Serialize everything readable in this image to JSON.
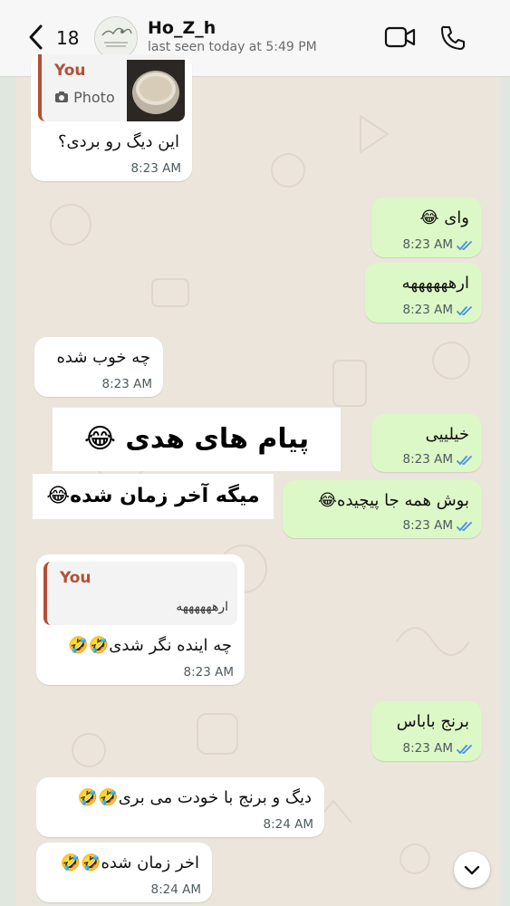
{
  "header": {
    "back_count": "18",
    "contact_name": "Ho_Z_h",
    "last_seen": "last seen today at 5:49 PM"
  },
  "messages": [
    {
      "dir": "in",
      "quote_author": "You",
      "quote_text": "Photo",
      "text": "این دیگ رو بردی؟",
      "time": "8:23 AM"
    },
    {
      "dir": "out",
      "text": "وای 😂",
      "time": "8:23 AM"
    },
    {
      "dir": "out",
      "text": "ارههههههه",
      "time": "8:23 AM"
    },
    {
      "dir": "in",
      "text": "چه خوب شده",
      "time": "8:23 AM"
    },
    {
      "dir": "out",
      "text": "خیلییی",
      "time": "8:23 AM"
    },
    {
      "dir": "out",
      "text": "بوش همه جا پیچیده😂",
      "time": "8:23 AM"
    },
    {
      "dir": "in",
      "quote_author": "You",
      "quote_text": "ارههههههه",
      "text": "چه اینده نگر شدی🤣🤣",
      "time": "8:23 AM"
    },
    {
      "dir": "out",
      "text": "برنج باباس",
      "time": "8:23 AM"
    },
    {
      "dir": "in",
      "text": "دیگ  و برنج با خودت می بری🤣🤣",
      "time": "8:24 AM"
    },
    {
      "dir": "in",
      "text": "اخر زمان شده🤣🤣",
      "time": "8:24 AM"
    }
  ],
  "sticker": {
    "line1": "پیام  های  هدی  😂",
    "line2": "میگه  آخر  زمان  شده😂"
  },
  "icons": {
    "back": "chevron-left-icon",
    "video": "video-call-icon",
    "phone": "phone-icon",
    "camera": "camera-icon",
    "read": "double-check-icon",
    "scroll": "chevron-down-icon"
  },
  "colors": {
    "incoming": "#ffffff",
    "outgoing": "#dcf8c6",
    "quote_accent": "#b34f36",
    "read_ticks": "#4a90e2",
    "chat_background": "#ece5dc"
  }
}
